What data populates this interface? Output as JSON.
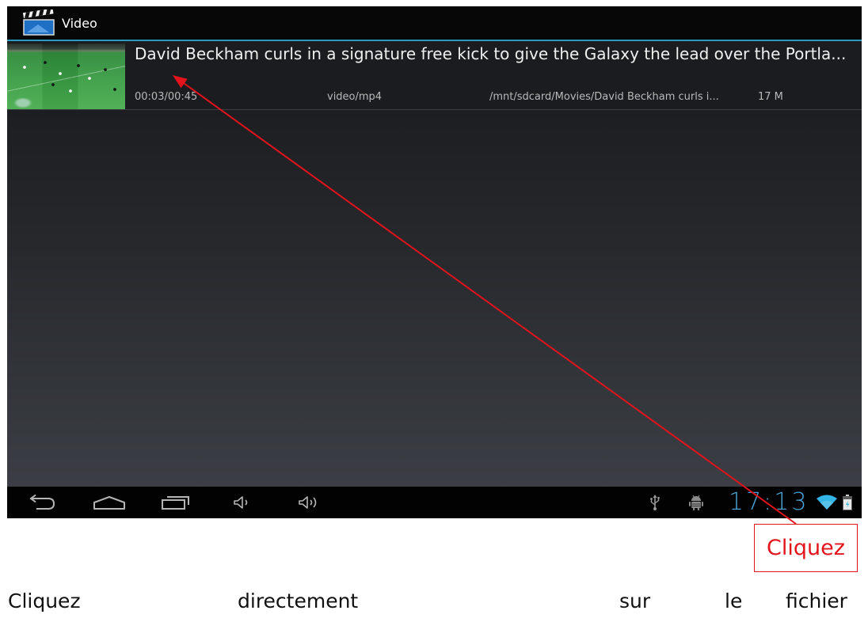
{
  "app": {
    "title": "Video",
    "icon": "clapperboard-icon"
  },
  "video_list": [
    {
      "title": "David Beckham curls in a signature free kick to give the Galaxy the lead over the Portla...",
      "duration": "00:03/00:45",
      "mime_type": "video/mp4",
      "path": "/mnt/sdcard/Movies/David Beckham curls i...",
      "size": "17 M"
    }
  ],
  "navigation_bar": {
    "buttons": [
      "back-icon",
      "home-icon",
      "recent-apps-icon",
      "volume-down-icon",
      "volume-up-icon"
    ]
  },
  "status_bar": {
    "icons": [
      "usb-icon",
      "usb-debugging-icon",
      "wifi-icon",
      "battery-icon"
    ],
    "clock": "17:13"
  },
  "annotation": {
    "label": "Cliquez"
  },
  "caption": {
    "words": [
      "Cliquez",
      "directement",
      "sur",
      "le",
      "fichier"
    ]
  },
  "colors": {
    "annotation": "#e3131b",
    "clock": "#4aa3d3",
    "accent_line": "#33b5e5",
    "wifi": "#33b5e5"
  }
}
